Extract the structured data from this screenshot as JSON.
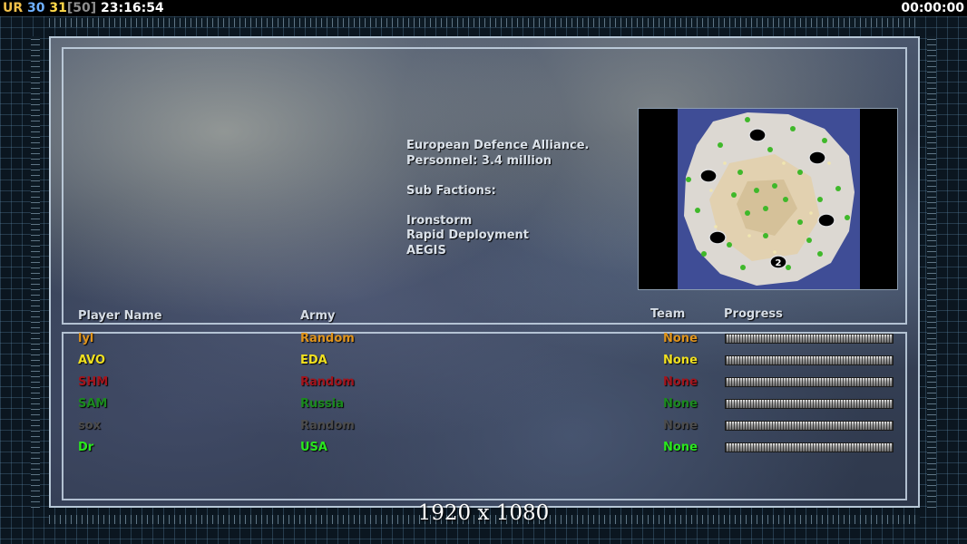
{
  "hud": {
    "ur": "UR",
    "val_a": "30",
    "val_b": "31",
    "val_c": "[50]",
    "clock": "23:16:54",
    "timer": "00:00:00"
  },
  "faction": {
    "lines": [
      "European Defence Alliance.",
      "Personnel: 3.4 million",
      "",
      "Sub Factions:",
      "",
      "Ironstorm",
      "Rapid Deployment",
      "AEGIS"
    ]
  },
  "columns": {
    "player": "Player Name",
    "army": "Army",
    "team": "Team",
    "progress": "Progress"
  },
  "players": [
    {
      "name": "lyl",
      "army": "Random",
      "team": "None",
      "color": "#e0941c",
      "progress": 0
    },
    {
      "name": "AVO",
      "army": "EDA",
      "team": "None",
      "color": "#f0e020",
      "progress": 0
    },
    {
      "name": "SHM",
      "army": "Random",
      "team": "None",
      "color": "#a3141c",
      "progress": 0
    },
    {
      "name": "SAM",
      "army": "Russia",
      "team": "None",
      "color": "#1b8a1e",
      "progress": 0
    },
    {
      "name": "sox",
      "army": "Random",
      "team": "None",
      "color": "#4c4c4c",
      "progress": 0
    },
    {
      "name": "Dr",
      "army": "USA",
      "team": "None",
      "color": "#2ae81e",
      "progress": 0
    }
  ],
  "minimap": {
    "marker_label": "2"
  },
  "resolution": "1920 x 1080"
}
